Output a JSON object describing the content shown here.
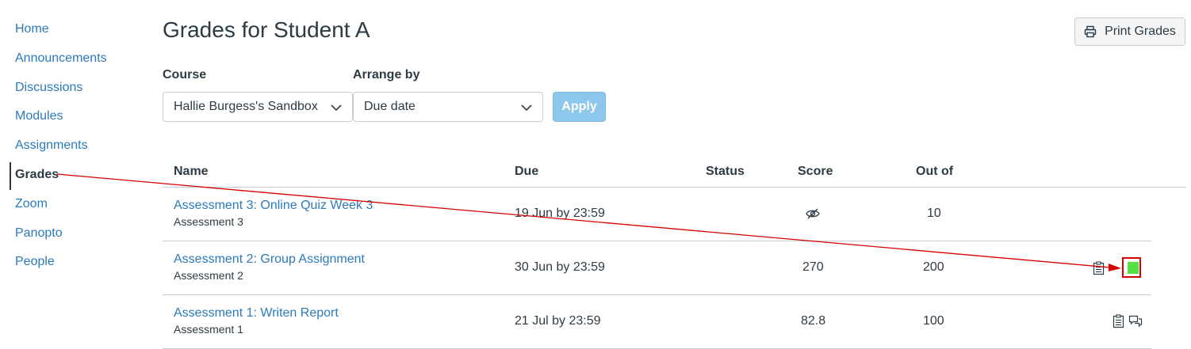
{
  "sidebar": {
    "items": [
      {
        "label": "Home"
      },
      {
        "label": "Announcements"
      },
      {
        "label": "Discussions"
      },
      {
        "label": "Modules"
      },
      {
        "label": "Assignments"
      },
      {
        "label": "Grades"
      },
      {
        "label": "Zoom"
      },
      {
        "label": "Panopto"
      },
      {
        "label": "People"
      }
    ],
    "active": "Grades"
  },
  "header": {
    "title": "Grades for Student A",
    "print_label": "Print Grades"
  },
  "filters": {
    "course_label": "Course",
    "course_value": "Hallie Burgess's Sandbox",
    "arrange_label": "Arrange by",
    "arrange_value": "Due date",
    "apply_label": "Apply"
  },
  "table": {
    "columns": [
      "Name",
      "Due",
      "Status",
      "Score",
      "Out of"
    ],
    "rows": [
      {
        "name": "Assessment 3: Online Quiz Week 3",
        "group": "Assessment 3",
        "due": "19 Jun by 23:59",
        "status": "",
        "score": "",
        "score_icon": "eye-hidden-icon",
        "out_of": "10"
      },
      {
        "name": "Assessment 2: Group Assignment",
        "group": "Assessment 2",
        "due": "30 Jun by 23:59",
        "status": "",
        "score": "270",
        "out_of": "200"
      },
      {
        "name": "Assessment 1: Writen Report",
        "group": "Assessment 1",
        "due": "21 Jul by 23:59",
        "status": "",
        "score": "82.8",
        "out_of": "100"
      }
    ]
  },
  "annotation": {
    "arrow_color": "#d40000",
    "highlight_color": "#d40000",
    "marker_fill": "#55e044"
  },
  "colors": {
    "link": "#2b7abc",
    "text": "#2d3b45",
    "apply_bg": "#8ec7ec"
  }
}
